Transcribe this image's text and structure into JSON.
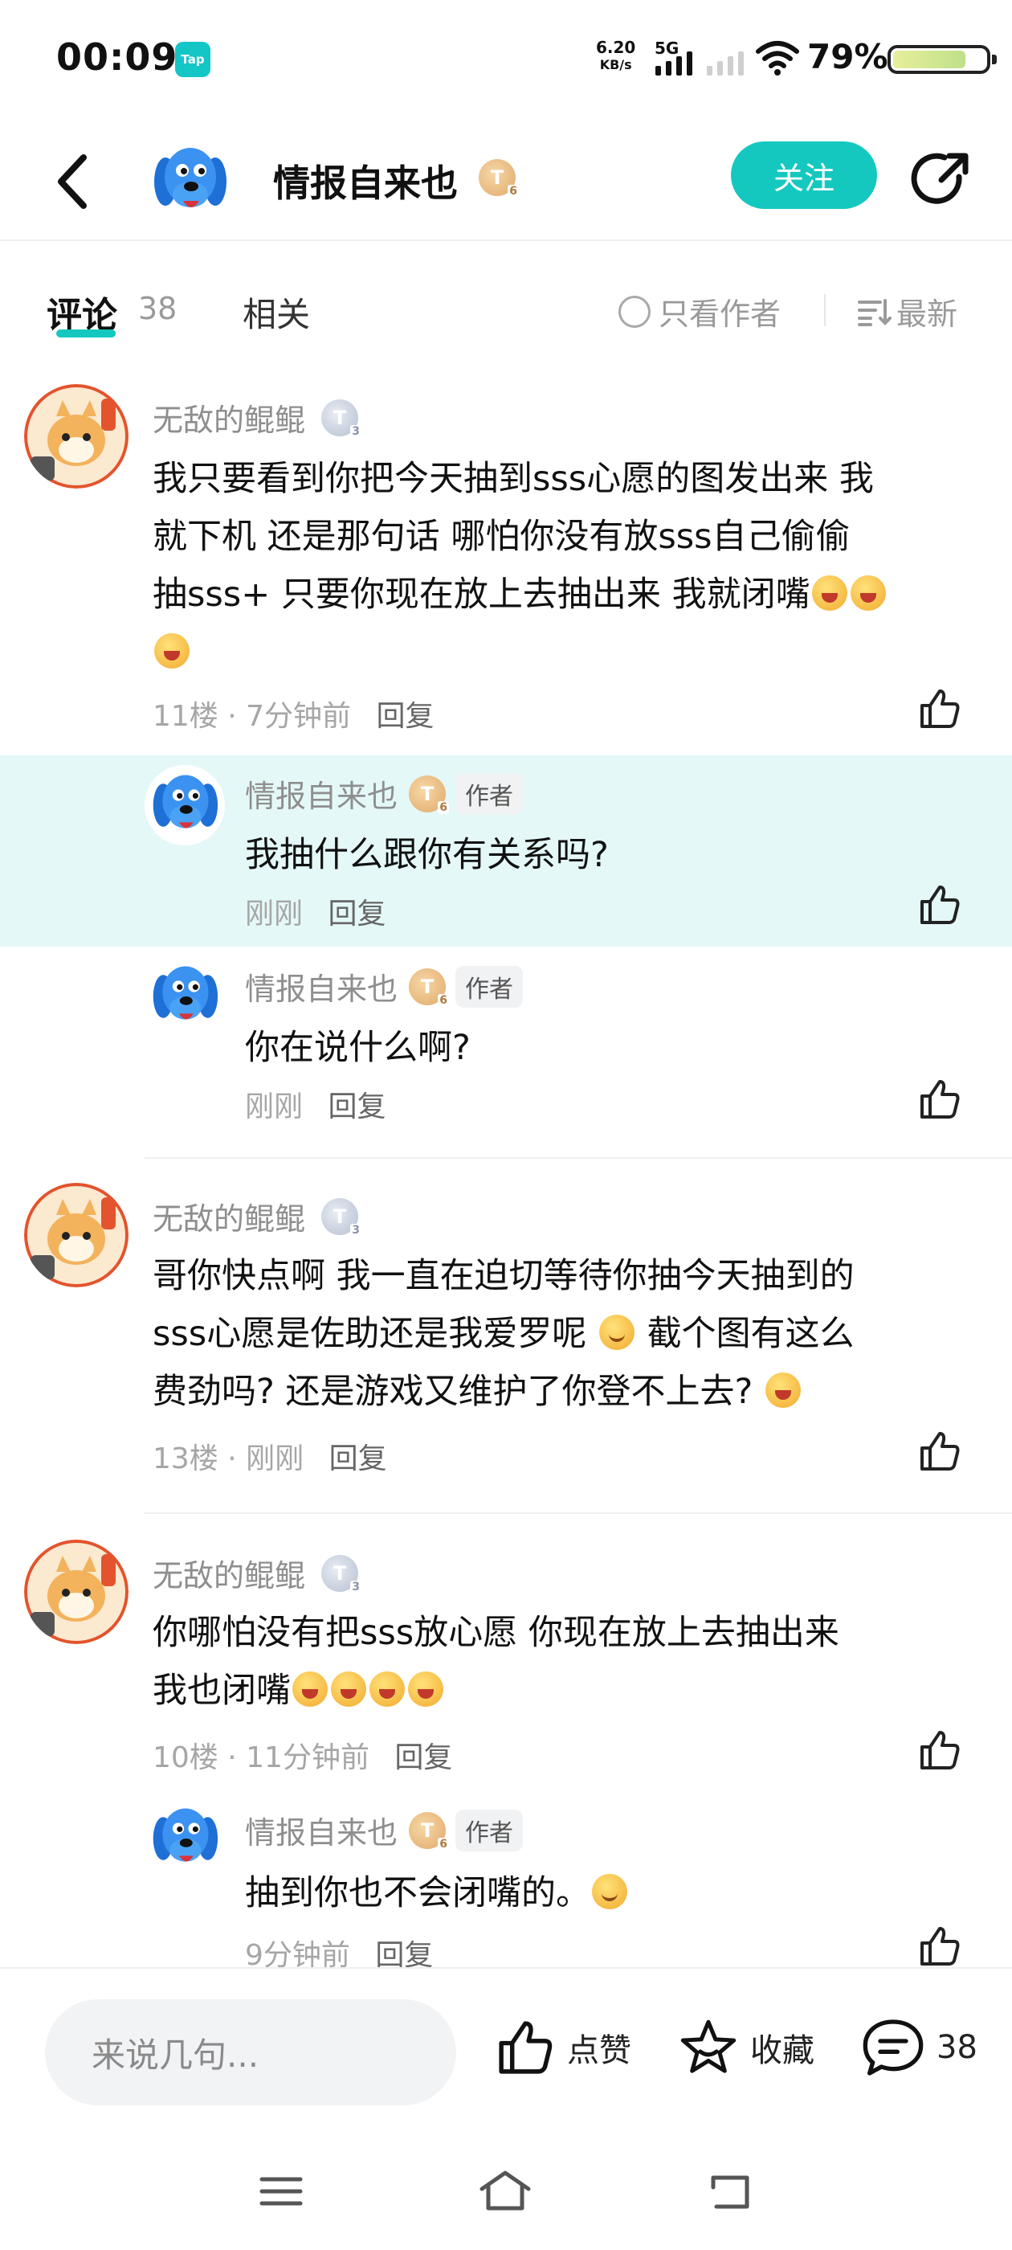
{
  "status_bar": {
    "time": "00:09",
    "app_badge": "Tap",
    "net_speed_value": "6.20",
    "net_speed_unit": "KB/s",
    "signal_label": "5G",
    "battery_percent": "79%",
    "battery_level": 0.79
  },
  "header": {
    "user_name": "情报自来也",
    "level_letter": "T",
    "level_num": "6",
    "follow_label": "关注"
  },
  "tabs": {
    "comments_label": "评论",
    "comments_count": "38",
    "related_label": "相关",
    "author_only_label": "只看作者",
    "sort_label": "最新"
  },
  "comments": [
    {
      "user": "无敌的鲲鲲",
      "level_letter": "T",
      "level_num": "3",
      "lines": [
        "我只要看到你把今天抽到sss心愿的图发出来 我",
        "就下机  还是那句话 哪怕你没有放sss自己偷偷",
        "抽sss+ 只要你现在放上去抽出来 我就闭嘴"
      ],
      "floor": "11楼",
      "time": "7分钟前",
      "reply_label": "回复",
      "replies": [
        {
          "user": "情报自来也",
          "level_letter": "T",
          "level_num": "6",
          "tag": "作者",
          "text": "我抽什么跟你有关系吗?",
          "time": "刚刚",
          "reply_label": "回复"
        },
        {
          "user": "情报自来也",
          "level_letter": "T",
          "level_num": "6",
          "tag": "作者",
          "text": "你在说什么啊?",
          "time": "刚刚",
          "reply_label": "回复"
        }
      ]
    },
    {
      "user": "无敌的鲲鲲",
      "level_letter": "T",
      "level_num": "3",
      "lines": [
        "哥你快点啊 我一直在迫切等待你抽今天抽到的",
        "sss心愿是佐助还是我爱罗呢",
        "费劲吗?  还是游戏又维护了你登不上去?"
      ],
      "line2_tail": "截个图有这么",
      "floor": "13楼",
      "time": "刚刚",
      "reply_label": "回复"
    },
    {
      "user": "无敌的鲲鲲",
      "level_letter": "T",
      "level_num": "3",
      "lines": [
        "你哪怕没有把sss放心愿 你现在放上去抽出来",
        "我也闭嘴"
      ],
      "floor": "10楼",
      "time": "11分钟前",
      "reply_label": "回复",
      "replies": [
        {
          "user": "情报自来也",
          "level_letter": "T",
          "level_num": "6",
          "tag": "作者",
          "text": "抽到你也不会闭嘴的。",
          "time": "9分钟前",
          "reply_label": "回复"
        }
      ]
    }
  ],
  "bottom_bar": {
    "input_placeholder": "来说几句...",
    "like_label": "点赞",
    "collect_label": "收藏",
    "comment_count": "38"
  },
  "icons": {
    "back": "back-arrow-icon",
    "share": "share-icon",
    "like": "thumbs-up-icon",
    "collect": "star-icon",
    "comment": "comment-bubble-icon",
    "sort": "sort-list-icon",
    "nav_menu": "menu-icon",
    "nav_home": "home-icon",
    "nav_back": "nav-back-icon"
  },
  "colors": {
    "accent": "#14c8c0",
    "highlight_bg": "#e4f8f7",
    "secondary_text": "#8e8e8e"
  }
}
